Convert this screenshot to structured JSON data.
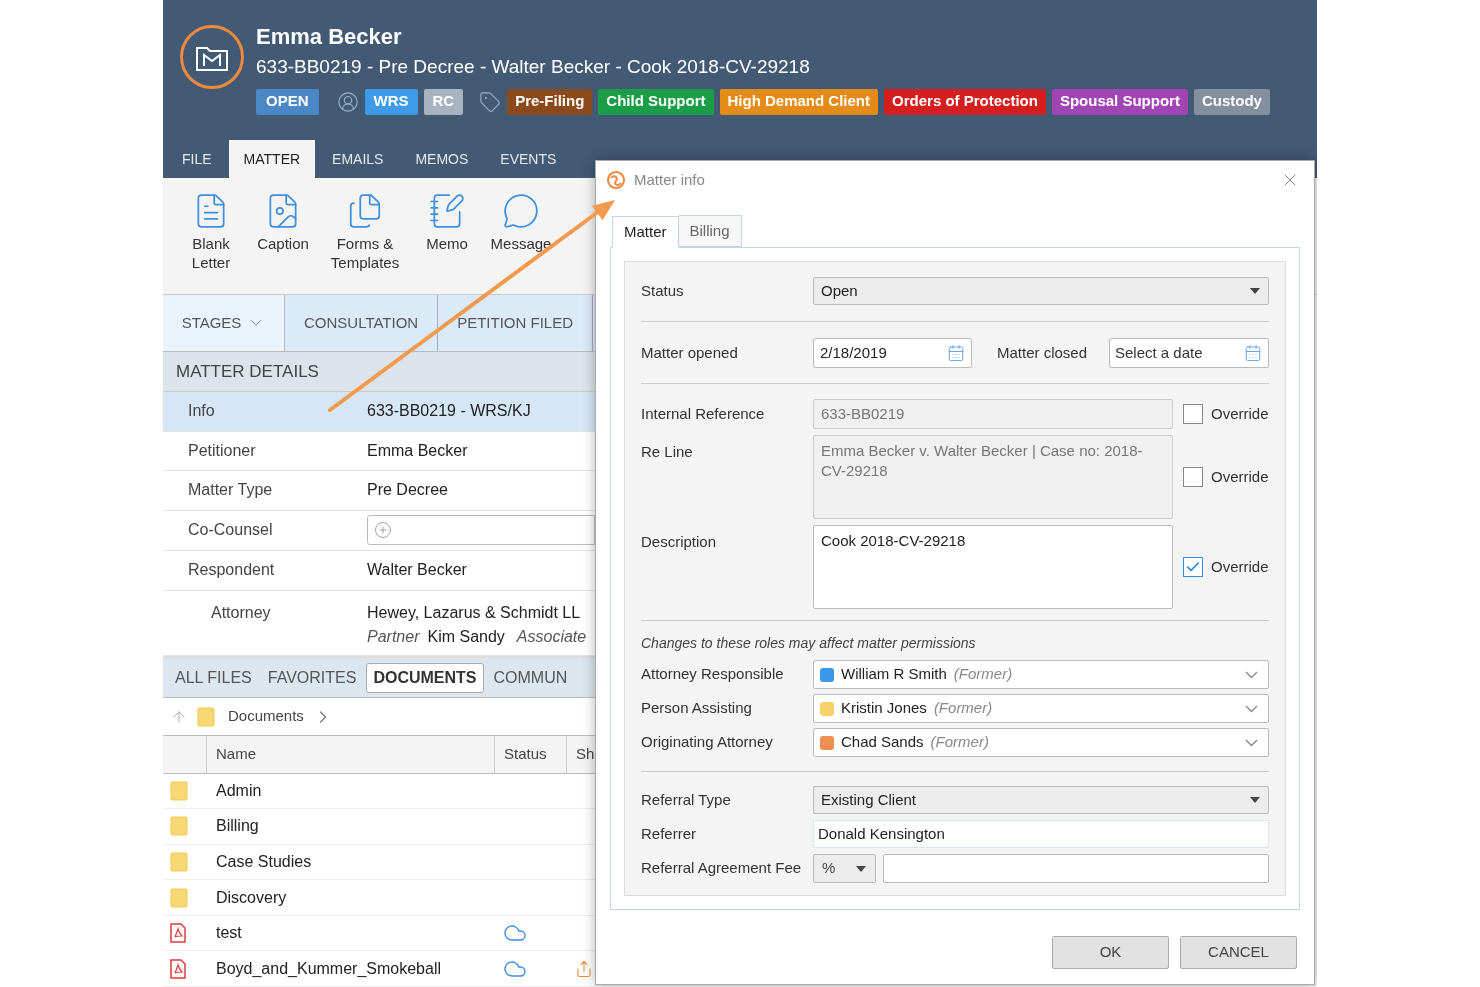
{
  "header": {
    "name": "Emma Becker",
    "subtitle": "633-BB0219 - Pre Decree - Walter Becker - Cook 2018-CV-29218",
    "status_badge": {
      "label": "OPEN",
      "color": "#4b86c6"
    },
    "staff_tags": [
      {
        "label": "WRS",
        "color": "#3d9be9"
      },
      {
        "label": "RC",
        "color": "#a7b3c1"
      }
    ],
    "tags": [
      {
        "label": "Pre-Filing",
        "color": "#8b4a1c"
      },
      {
        "label": "Child Support",
        "color": "#1a9d47"
      },
      {
        "label": "High Demand Client",
        "color": "#e58b17"
      },
      {
        "label": "Orders of Protection",
        "color": "#d51f1f"
      },
      {
        "label": "Spousal Support",
        "color": "#a045b3"
      },
      {
        "label": "Custody",
        "color": "#838f9c"
      }
    ]
  },
  "main_tabs": [
    {
      "label": "FILE",
      "selected": false
    },
    {
      "label": "MATTER",
      "selected": true
    },
    {
      "label": "EMAILS",
      "selected": false
    },
    {
      "label": "MEMOS",
      "selected": false
    },
    {
      "label": "EVENTS",
      "selected": false
    }
  ],
  "ribbon": [
    {
      "kind": "letter",
      "label": "Blank Letter"
    },
    {
      "kind": "caption",
      "label": "Caption"
    },
    {
      "kind": "forms",
      "label": "Forms & Templates"
    },
    {
      "kind": "memo",
      "label": "Memo"
    },
    {
      "kind": "message",
      "label": "Message"
    }
  ],
  "stages": {
    "label": "STAGES",
    "items": [
      "CONSULTATION",
      "PETITION FILED"
    ]
  },
  "matter_details": {
    "title": "MATTER DETAILS",
    "rows": [
      {
        "kind": "text",
        "label": "Info",
        "value": "633-BB0219 - WRS/KJ",
        "selected": true
      },
      {
        "kind": "text",
        "label": "Petitioner",
        "value": "Emma Becker",
        "selected": false
      },
      {
        "kind": "text",
        "label": "Matter Type",
        "value": "Pre Decree",
        "selected": false
      },
      {
        "kind": "add",
        "label": "Co-Counsel",
        "selected": false
      },
      {
        "kind": "text",
        "label": "Respondent",
        "value": "Walter Becker",
        "selected": false,
        "children": [
          {
            "kind": "attorney",
            "label": "Attorney",
            "value": "Hewey, Lazarus & Schmidt LL",
            "roles": [
              {
                "role": "Partner",
                "name": "Kim Sandy"
              },
              {
                "role": "Associate"
              }
            ],
            "selected": false
          }
        ]
      }
    ]
  },
  "file_tabs": [
    {
      "label": "ALL FILES",
      "selected": false
    },
    {
      "label": "FAVORITES",
      "selected": false
    },
    {
      "label": "DOCUMENTS",
      "selected": true
    },
    {
      "label": "COMMUN",
      "selected": false
    }
  ],
  "breadcrumb": "Documents",
  "files": {
    "columns": [
      "Name",
      "Status",
      "Sh"
    ],
    "rows": [
      {
        "kind": "folder",
        "name": "Admin",
        "synced": false,
        "column_3_icon": false
      },
      {
        "kind": "folder",
        "name": "Billing",
        "synced": false,
        "column_3_icon": false
      },
      {
        "kind": "folder",
        "name": "Case Studies",
        "synced": false,
        "column_3_icon": false
      },
      {
        "kind": "folder",
        "name": "Discovery",
        "synced": false,
        "column_3_icon": false
      },
      {
        "kind": "pdf",
        "name": "test",
        "synced": true,
        "column_3_icon": false
      },
      {
        "kind": "pdf",
        "name": "Boyd_and_Kummer_Smokeball",
        "synced": true,
        "column_3_icon": true
      }
    ]
  },
  "dialog": {
    "title": "Matter info",
    "tabs": [
      {
        "label": "Matter",
        "selected": true
      },
      {
        "label": "Billing",
        "selected": false
      }
    ],
    "status": {
      "label": "Status",
      "value": "Open"
    },
    "matter_opened": {
      "label": "Matter opened",
      "value": "2/18/2019"
    },
    "matter_closed": {
      "label": "Matter closed",
      "placeholder": "Select a date"
    },
    "internal_reference": {
      "label": "Internal Reference",
      "value": "633-BB0219",
      "override": false,
      "override_label": "Override"
    },
    "re_line": {
      "label": "Re Line",
      "value": "Emma Becker v. Walter Becker | Case no: 2018-CV-29218",
      "override": false,
      "override_label": "Override"
    },
    "description": {
      "label": "Description",
      "value": "Cook 2018-CV-29218",
      "override": true,
      "override_label": "Override"
    },
    "roles_note": "Changes to these roles may affect matter permissions",
    "roles": [
      {
        "label": "Attorney Responsible",
        "name": "William R Smith",
        "note": "(Former)",
        "color": "#3a98e8"
      },
      {
        "label": "Person Assisting",
        "name": "Kristin Jones",
        "note": "(Former)",
        "color": "#f6d36a"
      },
      {
        "label": "Originating Attorney",
        "name": "Chad Sands",
        "note": "(Former)",
        "color": "#ee8f52"
      }
    ],
    "referral_type": {
      "label": "Referral Type",
      "value": "Existing Client"
    },
    "referrer": {
      "label": "Referrer",
      "value": "Donald Kensington"
    },
    "referral_fee": {
      "label": "Referral Agreement Fee",
      "unit": "%"
    },
    "buttons": [
      "OK",
      "CANCEL"
    ]
  }
}
